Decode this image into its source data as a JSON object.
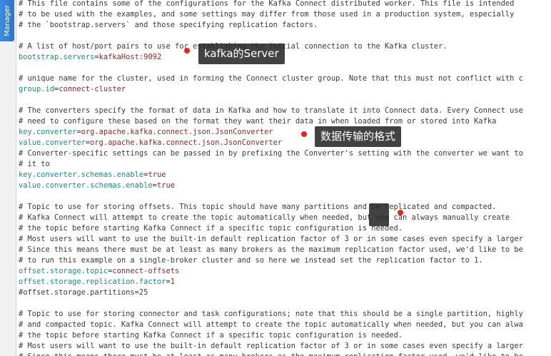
{
  "sidebar": {
    "tab_label": "Manager"
  },
  "editor": {
    "lines": [
      {
        "type": "comment",
        "text": "# This file contains some of the configurations for the Kafka Connect distributed worker. This file is intended"
      },
      {
        "type": "comment",
        "text": "# to be used with the examples, and some settings may differ from those used in a production system, especially"
      },
      {
        "type": "comment",
        "text": "# the `bootstrap.servers` and those specifying replication factors."
      },
      {
        "type": "blank",
        "text": ""
      },
      {
        "type": "comment",
        "text": "# A list of host/port pairs to use for establishing the initial connection to the Kafka cluster."
      },
      {
        "type": "kv",
        "key": "bootstrap.servers",
        "value": "kafkaHost:9092"
      },
      {
        "type": "blank",
        "text": ""
      },
      {
        "type": "comment",
        "text": "# unique name for the cluster, used in forming the Connect cluster group. Note that this must not conflict with c"
      },
      {
        "type": "kv",
        "key": "group.id",
        "value": "connect-cluster"
      },
      {
        "type": "blank",
        "text": ""
      },
      {
        "type": "comment",
        "text": "# The converters specify the format of data in Kafka and how to translate it into Connect data. Every Connect use"
      },
      {
        "type": "comment",
        "text": "# need to configure these based on the format they want their data in when loaded from or stored into Kafka"
      },
      {
        "type": "kv",
        "key": "key.converter",
        "value": "org.apache.kafka.connect.json.JsonConverter"
      },
      {
        "type": "kv",
        "key": "value.converter",
        "value": "org.apache.kafka.connect.json.JsonConverter"
      },
      {
        "type": "comment",
        "text": "# Converter-specific settings can be passed in by prefixing the Converter's setting with the converter we want to"
      },
      {
        "type": "comment",
        "text": "# it to"
      },
      {
        "type": "kv",
        "key": "key.converter.schemas.enable",
        "value": "true"
      },
      {
        "type": "kv",
        "key": "value.converter.schemas.enable",
        "value": "true"
      },
      {
        "type": "blank",
        "text": ""
      },
      {
        "type": "comment",
        "text": "# Topic to use for storing offsets. This topic should have many partitions and be replicated and compacted."
      },
      {
        "type": "comment",
        "text": "# Kafka Connect will attempt to create the topic automatically when needed, but you can always manually create"
      },
      {
        "type": "comment",
        "text": "# the topic before starting Kafka Connect if a specific topic configuration is needed."
      },
      {
        "type": "comment",
        "text": "# Most users will want to use the built-in default replication factor of 3 or in some cases even specify a larger"
      },
      {
        "type": "comment",
        "text": "# Since this means there must be at least as many brokers as the maximum replication factor used, we'd like to be"
      },
      {
        "type": "comment",
        "text": "# to run this example on a single-broker cluster and so here we instead set the replication factor to 1."
      },
      {
        "type": "kv",
        "key": "offset.storage.topic",
        "value": "connect-offsets"
      },
      {
        "type": "kv",
        "key": "offset.storage.replication.factor",
        "value": "1"
      },
      {
        "type": "comment",
        "text": "#offset.storage.partitions=25"
      },
      {
        "type": "blank",
        "text": ""
      },
      {
        "type": "comment",
        "text": "# Topic to use for storing connector and task configurations; note that this should be a single partition, highly"
      },
      {
        "type": "comment",
        "text": "# and compacted topic. Kafka Connect will attempt to create the topic automatically when needed, but you can alwa"
      },
      {
        "type": "comment",
        "text": "# the topic before starting Kafka Connect if a specific topic configuration is needed."
      },
      {
        "type": "comment",
        "text": "# Most users will want to use the built-in default replication factor of 3 or in some cases even specify a larger"
      },
      {
        "type": "comment",
        "text": "# Since this means there must be at least as many brokers as the maximum replication factor used, we'd like to be"
      }
    ]
  },
  "annotations": [
    {
      "label": "kafka的Server"
    },
    {
      "label": "数据传输的格式"
    },
    {
      "label": ""
    }
  ],
  "colors": {
    "comment": "#3a3a3a",
    "key": "#1e8a8a",
    "value": "#8a2a2a",
    "annotation_dot": "#e8261c",
    "sidebar_tab": "#2f74c8"
  }
}
